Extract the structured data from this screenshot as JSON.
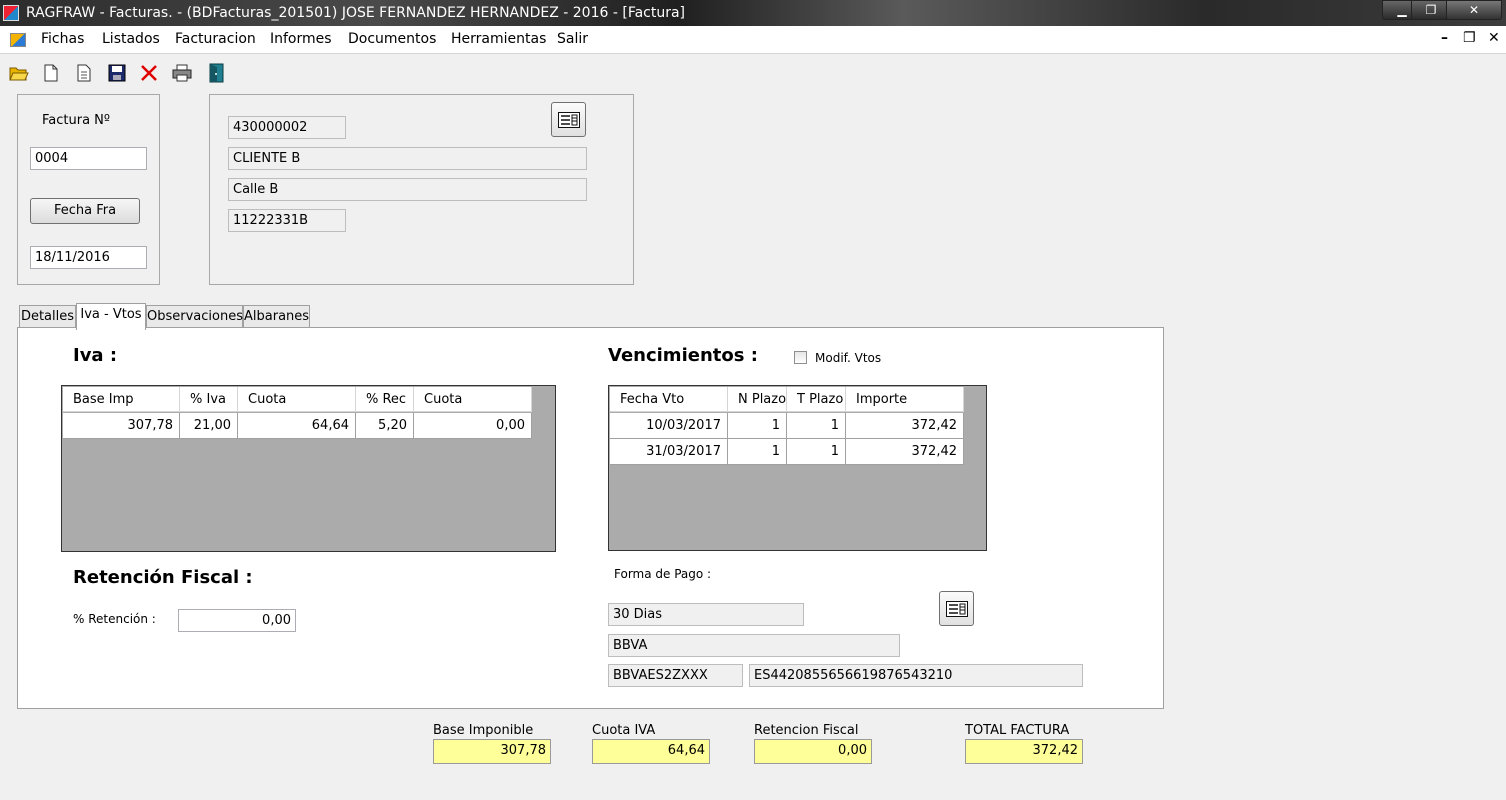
{
  "window": {
    "title": "RAGFRAW - Facturas. - (BDFacturas_201501)   JOSE FERNANDEZ HERNANDEZ - 2016 - [Factura]",
    "minimize": "▁",
    "maximize": "❐",
    "close": "✕"
  },
  "menu": {
    "items": [
      "Fichas",
      "Listados",
      "Facturacion",
      "Informes",
      "Documentos",
      "Herramientas",
      "Salir"
    ],
    "mdi_minimize": "–",
    "mdi_restore": "❐",
    "mdi_close": "✕"
  },
  "toolbar": {
    "icons": [
      "open-folder-icon",
      "new-document-icon",
      "document-details-icon",
      "save-icon",
      "delete-icon",
      "print-icon",
      "exit-door-icon"
    ]
  },
  "invoice": {
    "number_label": "Factura Nº",
    "number": "0004",
    "date_button": "Fecha Fra",
    "date": "18/11/2016"
  },
  "client": {
    "code": "430000002",
    "name": "CLIENTE B",
    "address": "Calle B",
    "nif": "11222331B"
  },
  "tabs": [
    "Detalles",
    "Iva - Vtos",
    "Observaciones",
    "Albaranes"
  ],
  "iva": {
    "title": "Iva :",
    "headers": [
      "Base Imp",
      "% Iva",
      "Cuota",
      "% Rec",
      "Cuota"
    ],
    "rows": [
      [
        "307,78",
        "21,00",
        "64,64",
        "5,20",
        "0,00"
      ]
    ]
  },
  "vencimientos": {
    "title": "Vencimientos :",
    "modif_label": "Modif. Vtos",
    "headers": [
      "Fecha Vto",
      "N Plazo",
      "T Plazo",
      "Importe"
    ],
    "rows": [
      [
        "10/03/2017",
        "1",
        "1",
        "372,42"
      ],
      [
        "31/03/2017",
        "1",
        "1",
        "372,42"
      ]
    ]
  },
  "retencion": {
    "title": "Retención Fiscal :",
    "label": "% Retención :",
    "value": "0,00"
  },
  "pago": {
    "label": "Forma de Pago :",
    "forma": "30 Dias",
    "banco": "BBVA",
    "bic": "BBVAES2ZXXX",
    "iban": "ES4420855656619876543210"
  },
  "totals": {
    "base_label": "Base Imponible",
    "base": "307,78",
    "iva_label": "Cuota IVA",
    "iva": "64,64",
    "ret_label": "Retencion Fiscal",
    "ret": "0,00",
    "total_label": "TOTAL FACTURA",
    "total": "372,42"
  }
}
